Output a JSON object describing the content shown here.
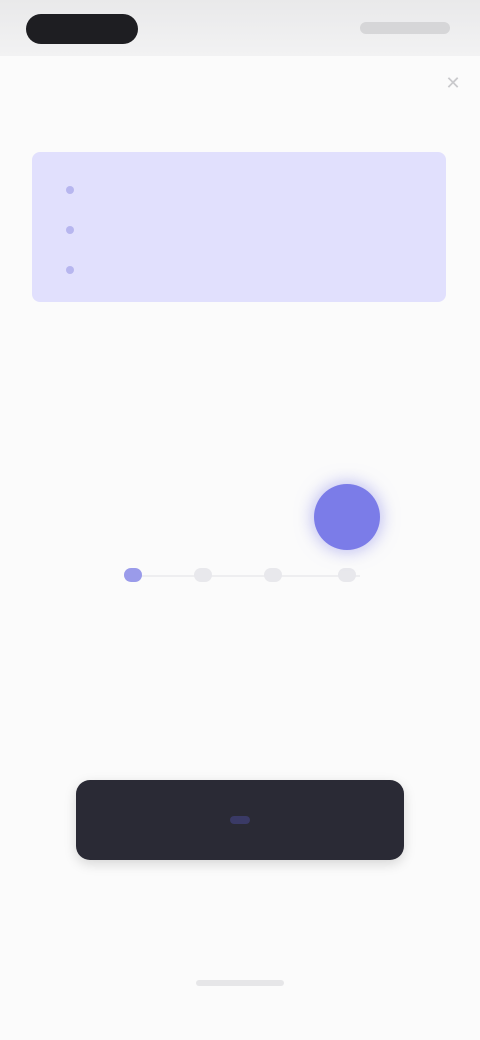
{
  "header": {
    "title": "",
    "close_glyph": "✕"
  },
  "info_card": {
    "rows": [
      "",
      "",
      ""
    ],
    "accent_color": "#e1e0fd"
  },
  "section1": {
    "heading": "",
    "body": ""
  },
  "selector": {
    "steps": 4,
    "selected_index": 3,
    "accent_color": "#7b7ce8"
  },
  "section2": {
    "heading": "",
    "body": ""
  },
  "primary_button": {
    "label": ""
  },
  "colors": {
    "button_bg": "#2a2a35",
    "text_primary": "#2a2a2e",
    "text_secondary": "#8a8a90"
  }
}
